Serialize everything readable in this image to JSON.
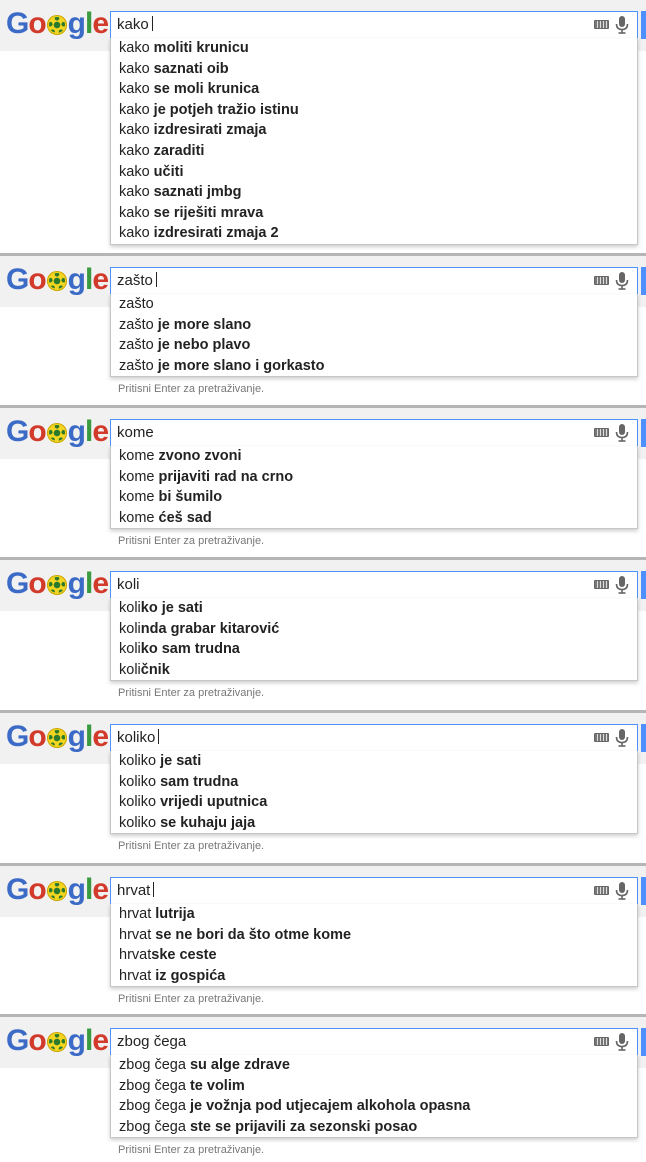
{
  "logo": {
    "G": "G",
    "o1": "o",
    "ball": "o",
    "g": "g",
    "l": "l",
    "e": "e"
  },
  "hint_text": "Pritisni Enter za pretraživanje.",
  "colors": {
    "focus_border": "#4d90fe",
    "header_bg": "#f1f1f1",
    "divider": "#b5b5b5"
  },
  "panels": [
    {
      "query": "kako",
      "caret": true,
      "show_hint": false,
      "suggestions": [
        {
          "typed": "kako ",
          "comp": "moliti krunicu"
        },
        {
          "typed": "kako ",
          "comp": "saznati oib"
        },
        {
          "typed": "kako ",
          "comp": "se moli krunica"
        },
        {
          "typed": "kako ",
          "comp": "je potjeh tražio istinu"
        },
        {
          "typed": "kako ",
          "comp": "izdresirati zmaja"
        },
        {
          "typed": "kako ",
          "comp": "zaraditi"
        },
        {
          "typed": "kako ",
          "comp": "učiti"
        },
        {
          "typed": "kako ",
          "comp": "saznati jmbg"
        },
        {
          "typed": "kako ",
          "comp": "se riješiti mrava"
        },
        {
          "typed": "kako ",
          "comp": "izdresirati zmaja 2"
        }
      ]
    },
    {
      "query": "zašto",
      "caret": true,
      "show_hint": true,
      "suggestions": [
        {
          "typed": "zašto",
          "comp": ""
        },
        {
          "typed": "zašto ",
          "comp": "je more slano"
        },
        {
          "typed": "zašto ",
          "comp": "je nebo plavo"
        },
        {
          "typed": "zašto ",
          "comp": "je more slano i gorkasto"
        }
      ]
    },
    {
      "query": "kome",
      "caret": false,
      "show_hint": true,
      "suggestions": [
        {
          "typed": "kome ",
          "comp": "zvono zvoni"
        },
        {
          "typed": "kome ",
          "comp": "prijaviti rad na crno"
        },
        {
          "typed": "kome ",
          "comp": "bi šumilo"
        },
        {
          "typed": "kome ",
          "comp": "ćeš sad"
        }
      ]
    },
    {
      "query": "koli",
      "caret": false,
      "show_hint": true,
      "suggestions": [
        {
          "typed": "koli",
          "comp": "ko je sati"
        },
        {
          "typed": "koli",
          "comp": "nda grabar kitarović"
        },
        {
          "typed": "koli",
          "comp": "ko sam trudna"
        },
        {
          "typed": "koli",
          "comp": "čnik"
        }
      ]
    },
    {
      "query": "koliko",
      "caret": true,
      "show_hint": true,
      "suggestions": [
        {
          "typed": "koliko ",
          "comp": "je sati"
        },
        {
          "typed": "koliko ",
          "comp": "sam trudna"
        },
        {
          "typed": "koliko ",
          "comp": "vrijedi uputnica"
        },
        {
          "typed": "koliko ",
          "comp": "se kuhaju jaja"
        }
      ]
    },
    {
      "query": "hrvat",
      "caret": true,
      "show_hint": true,
      "suggestions": [
        {
          "typed": "hrvat ",
          "comp": "lutrija"
        },
        {
          "typed": "hrvat ",
          "comp": "se ne bori da što otme kome"
        },
        {
          "typed": "hrvat",
          "comp": "ske ceste"
        },
        {
          "typed": "hrvat ",
          "comp": "iz gospića"
        }
      ]
    },
    {
      "query": "zbog čega",
      "caret": false,
      "show_hint": true,
      "suggestions": [
        {
          "typed": "zbog čega ",
          "comp": "su alge zdrave"
        },
        {
          "typed": "zbog čega ",
          "comp": "te volim"
        },
        {
          "typed": "zbog čega ",
          "comp": "je vožnja pod utjecajem alkohola opasna"
        },
        {
          "typed": "zbog čega ",
          "comp": "ste se prijavili za sezonski posao"
        }
      ]
    }
  ]
}
